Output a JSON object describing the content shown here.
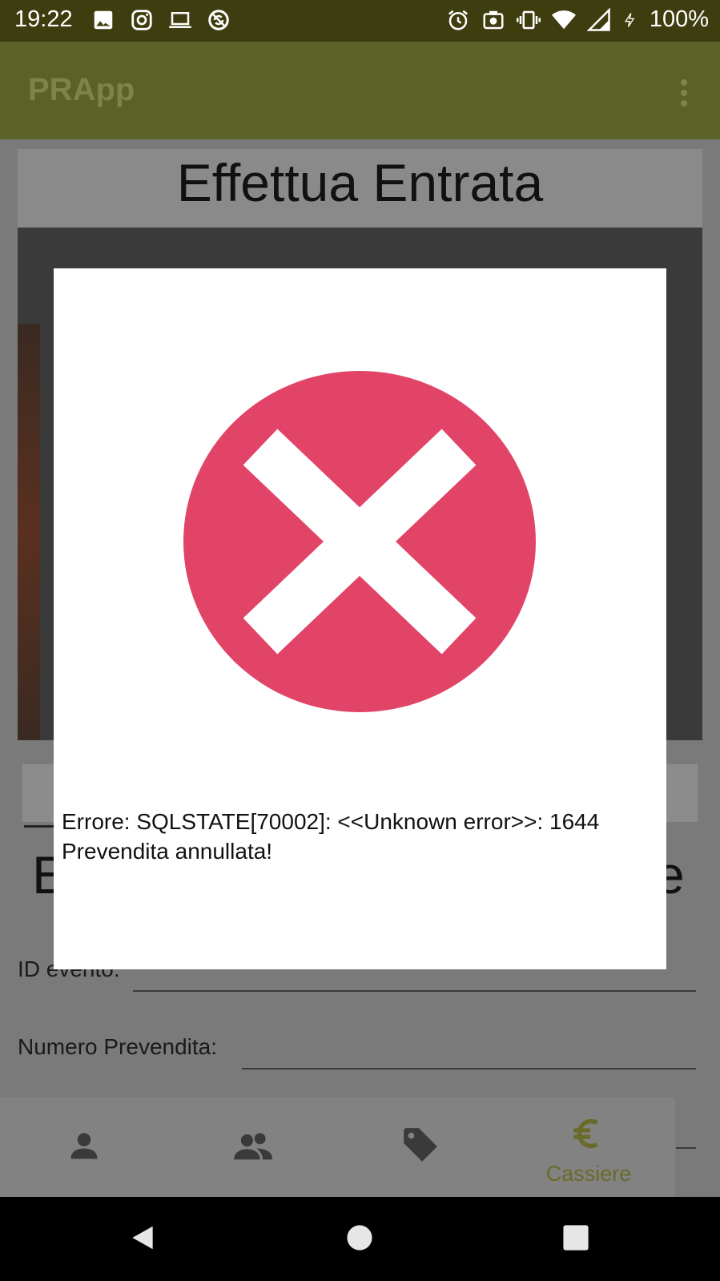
{
  "status_bar": {
    "time": "19:22",
    "battery": "100%",
    "left_icons": [
      "image-icon",
      "instagram-icon",
      "laptop-icon",
      "no-sync-icon"
    ],
    "right_icons": [
      "alarm-icon",
      "screenshot-icon",
      "vibrate-icon",
      "wifi-icon",
      "signal-icon",
      "charging-icon"
    ]
  },
  "app_bar": {
    "title": "PRApp",
    "menu_icon": "more-vert-icon"
  },
  "page": {
    "title": "Effettua Entrata",
    "partial_heading_left": "E",
    "partial_heading_right": "e",
    "fields": [
      {
        "label": "ID evento:",
        "value": ""
      },
      {
        "label": "Numero Prevendita:",
        "value": ""
      }
    ]
  },
  "bottom_nav": {
    "items": [
      {
        "icon": "person-icon",
        "label": ""
      },
      {
        "icon": "group-icon",
        "label": ""
      },
      {
        "icon": "tag-icon",
        "label": ""
      },
      {
        "icon": "euro-icon",
        "label": "Cassiere",
        "active": true
      }
    ]
  },
  "dialog": {
    "icon": "error-x-icon",
    "message": "Errore: SQLSTATE[70002]: <<Unknown error>>: 1644\nPrevendita annullata!"
  },
  "system_nav": {
    "buttons": [
      "back-icon",
      "home-icon",
      "recents-icon"
    ]
  },
  "colors": {
    "status_bar": "#3d3d0f",
    "app_bar": "#5c6127",
    "accent": "#6a6b28",
    "error_red": "#e24467",
    "scrim_content": "#7a7a7a"
  }
}
